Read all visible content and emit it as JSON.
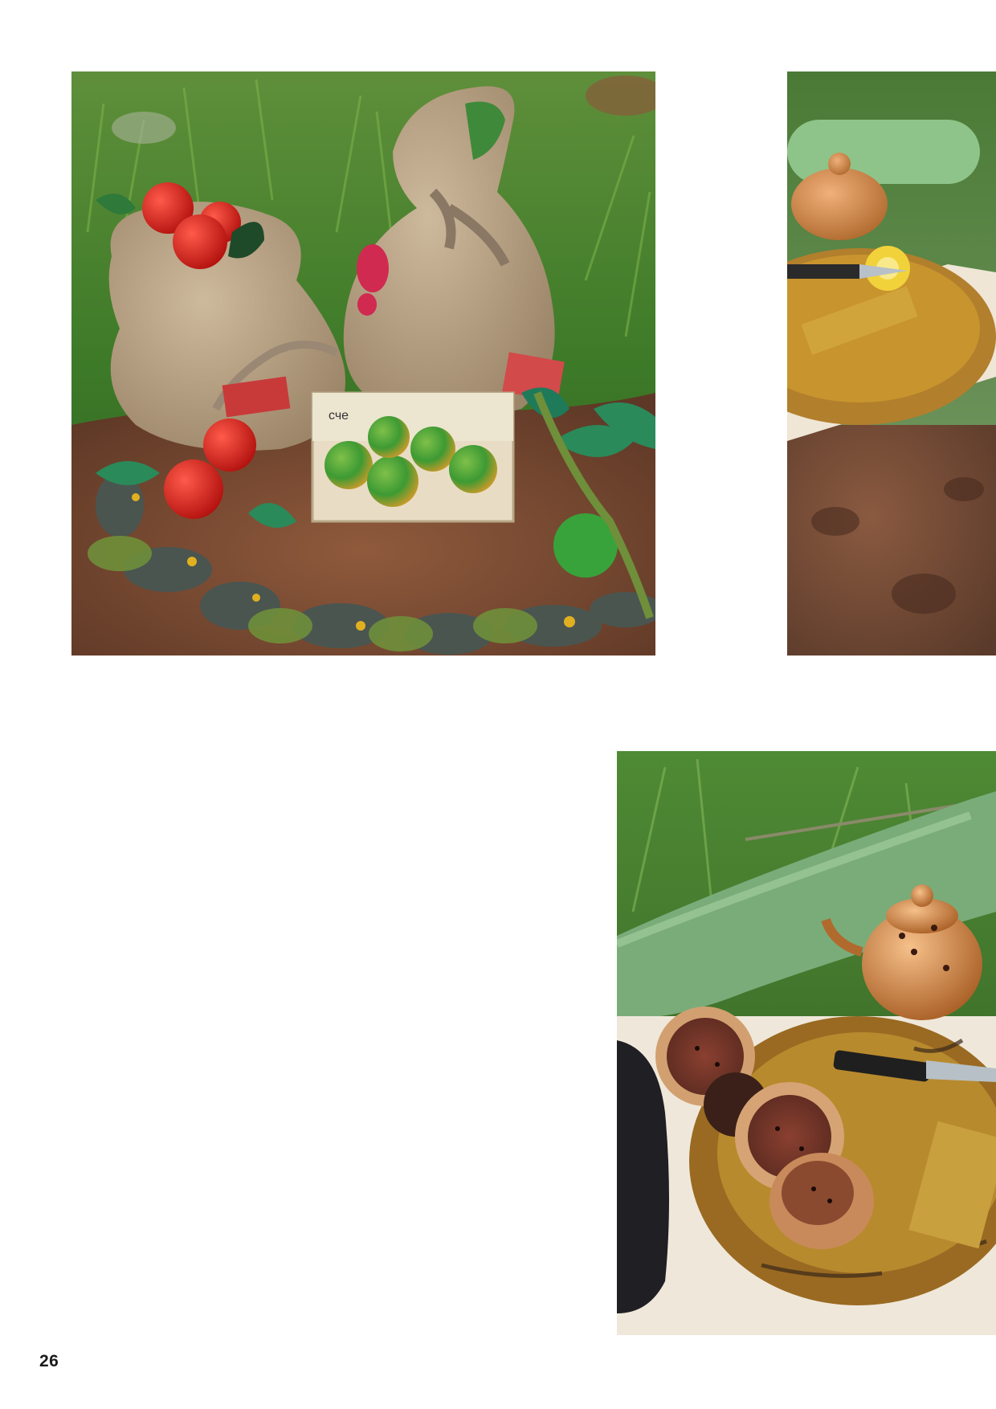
{
  "page": {
    "number": "26"
  },
  "photos": [
    {
      "subject": "burlap-sacks-with-clay-apples-and-crate",
      "crate_text": "сче"
    },
    {
      "subject": "clay-teapot-on-wooden-tray-cropped"
    },
    {
      "subject": "clay-teapot-cups-and-knife-on-tray-cropped"
    }
  ],
  "colors": {
    "background": "#ffffff",
    "grass": "#3f7a2c",
    "soil": "#7a4a34",
    "burlap": "#b7a184",
    "apple_red": "#d6201f",
    "apple_green": "#3f9a3a",
    "copper": "#c27a3e",
    "tray": "#b07a2a",
    "page_number": "#1a1a1a"
  }
}
